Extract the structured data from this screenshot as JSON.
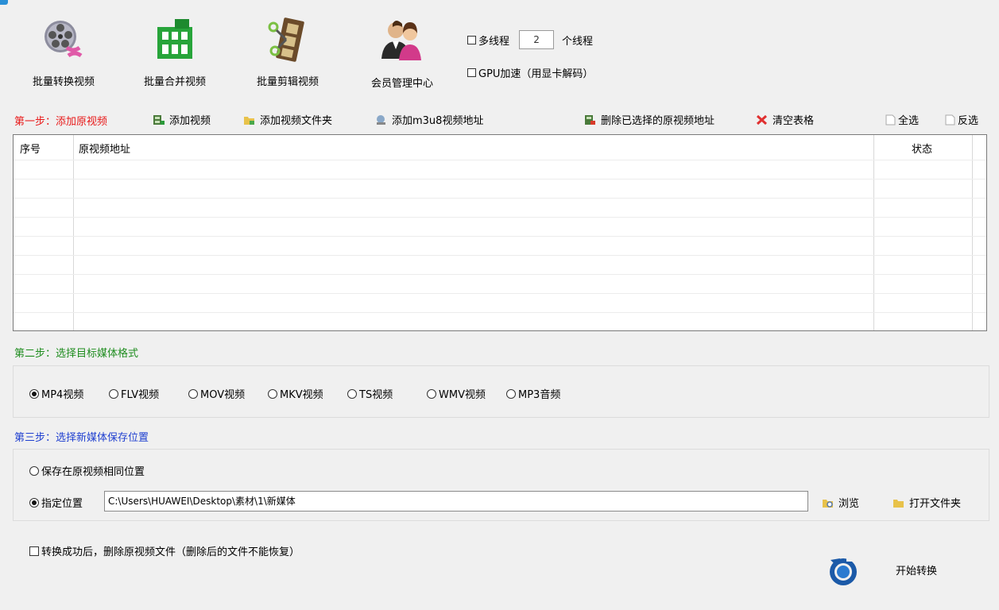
{
  "toolbar": {
    "batch_convert": "批量转换视频",
    "batch_merge": "批量合并视频",
    "batch_cut": "批量剪辑视频",
    "member_center": "会员管理中心",
    "multithread_label": "多线程",
    "thread_count": "2",
    "thread_unit": "个线程",
    "gpu_label": "GPU加速（用显卡解码）"
  },
  "step1": {
    "label": "第一步：添加原视频",
    "add_video": "添加视频",
    "add_folder": "添加视频文件夹",
    "add_m3u8": "添加m3u8视频地址",
    "delete_selected": "删除已选择的原视频地址",
    "clear_table": "清空表格",
    "select_all": "全选",
    "invert_select": "反选"
  },
  "table": {
    "col_index": "序号",
    "col_path": "原视频地址",
    "col_status": "状态"
  },
  "step2": {
    "label": "第二步：选择目标媒体格式",
    "formats": [
      "MP4视频",
      "FLV视频",
      "MOV视频",
      "MKV视频",
      "TS视频",
      "WMV视频",
      "MP3音频"
    ],
    "selected": "MP4视频"
  },
  "step3": {
    "label": "第三步：选择新媒体保存位置",
    "same_location": "保存在原视频相同位置",
    "specify_location": "指定位置",
    "path_value": "C:\\Users\\HUAWEI\\Desktop\\素材\\1\\新媒体",
    "browse": "浏览",
    "open_folder": "打开文件夹"
  },
  "footer": {
    "delete_after": "转换成功后，删除原视频文件（删除后的文件不能恢复）",
    "start": "开始转换"
  },
  "colors": {
    "step1": "#e81919",
    "step2": "#1e8c1e",
    "step3": "#2040d0"
  }
}
